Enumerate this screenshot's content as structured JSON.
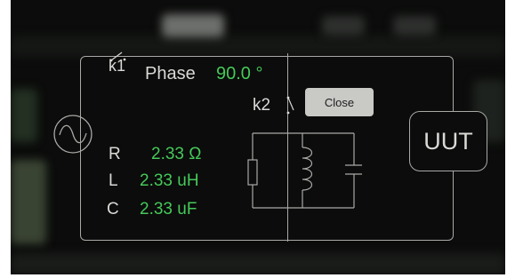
{
  "dialog": {
    "switch1_label": "k1",
    "switch2_label": "k2",
    "phase_label": "Phase",
    "phase_value": "90.0 °",
    "close_label": "Close",
    "uut_label": "UUT",
    "params": [
      {
        "label": "R",
        "value": "2.33 Ω"
      },
      {
        "label": "L",
        "value": "2.33 uH"
      },
      {
        "label": "C",
        "value": "2.33 uF"
      }
    ]
  },
  "colors": {
    "value_green": "#46c85a",
    "text_light": "#d9d9d6",
    "background": "#0b0c0b",
    "line": "#a9aaa6",
    "button": "#c9c9c6"
  },
  "icons": {
    "source": "ac-source-icon",
    "switch": "switch-icon",
    "circuit": "lc-circuit-icon"
  }
}
